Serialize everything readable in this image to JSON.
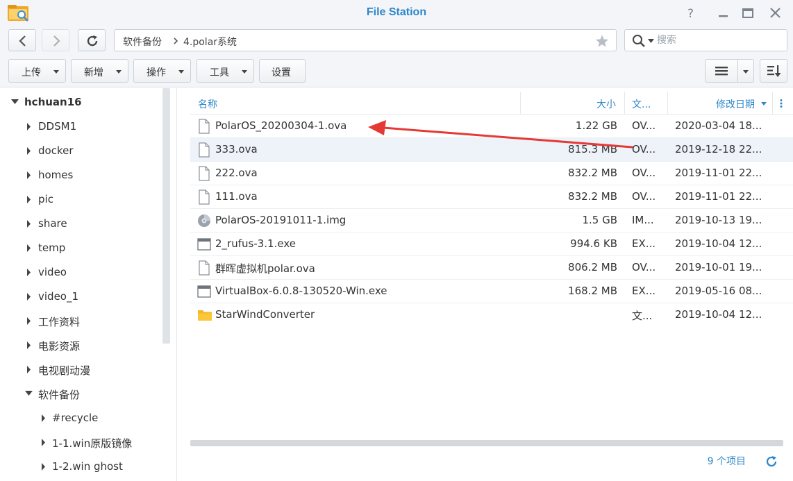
{
  "window": {
    "title": "File Station"
  },
  "nav": {
    "breadcrumb": [
      "软件备份",
      "4.polar系统"
    ]
  },
  "search": {
    "placeholder": "搜索"
  },
  "toolbar": {
    "upload": "上传",
    "create": "新增",
    "action": "操作",
    "tools": "工具",
    "settings": "设置"
  },
  "sidebar": {
    "root": "hchuan16",
    "items": [
      "DDSM1",
      "docker",
      "homes",
      "pic",
      "share",
      "temp",
      "video",
      "video_1",
      "工作资料",
      "电影资源",
      "电视剧动漫",
      "软件备份"
    ],
    "subitems": [
      "#recycle",
      "1-1.win原版镜像",
      "1-2.win ghost"
    ]
  },
  "list": {
    "columns": {
      "name": "名称",
      "size": "大小",
      "type": "文...",
      "modified": "修改日期"
    },
    "rows": [
      {
        "icon": "file-icon",
        "name": "PolarOS_20200304-1.ova",
        "size": "1.22 GB",
        "type": "OV...",
        "date": "2020-03-04 18..."
      },
      {
        "icon": "file-icon",
        "name": "333.ova",
        "size": "815.3 MB",
        "type": "OV...",
        "date": "2019-12-18 22..."
      },
      {
        "icon": "file-icon",
        "name": "222.ova",
        "size": "832.2 MB",
        "type": "OV...",
        "date": "2019-11-01 22..."
      },
      {
        "icon": "file-icon",
        "name": "111.ova",
        "size": "832.2 MB",
        "type": "OV...",
        "date": "2019-11-01 22..."
      },
      {
        "icon": "disc-image-icon",
        "name": "PolarOS-20191011-1.img",
        "size": "1.5 GB",
        "type": "IM...",
        "date": "2019-10-13 19..."
      },
      {
        "icon": "exe-icon",
        "name": "2_rufus-3.1.exe",
        "size": "994.6 KB",
        "type": "EX...",
        "date": "2019-10-04 12..."
      },
      {
        "icon": "file-icon",
        "name": "群晖虚拟机polar.ova",
        "size": "806.2 MB",
        "type": "OV...",
        "date": "2019-10-01 19..."
      },
      {
        "icon": "exe-icon",
        "name": "VirtualBox-6.0.8-130520-Win.exe",
        "size": "168.2 MB",
        "type": "EX...",
        "date": "2019-05-16 08..."
      },
      {
        "icon": "folder-icon",
        "name": "StarWindConverter",
        "size": "",
        "type": "文...",
        "date": "2019-10-04 12..."
      }
    ]
  },
  "status": {
    "count": "9 个项目"
  },
  "colors": {
    "accent": "#2d87c8",
    "annotation": "#e53935",
    "folder": "#f5b724"
  }
}
